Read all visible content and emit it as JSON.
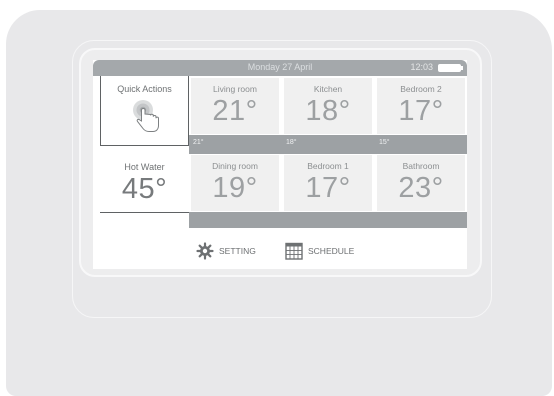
{
  "status_bar": {
    "date": "Monday 27 April",
    "time": "12:03"
  },
  "quick_actions": {
    "label": "Quick Actions"
  },
  "hot_water": {
    "label": "Hot Water",
    "temp": "45°"
  },
  "rooms": [
    {
      "name": "Living room",
      "temp": "21°"
    },
    {
      "name": "Kitchen",
      "temp": "18°"
    },
    {
      "name": "Bedroom 2",
      "temp": "17°"
    },
    {
      "name": "Dining room",
      "temp": "19°"
    },
    {
      "name": "Bedroom 1",
      "temp": "17°"
    },
    {
      "name": "Bathroom",
      "temp": "23°"
    }
  ],
  "mini_temps": [
    "21°",
    "18°",
    "15°"
  ],
  "toolbar": {
    "setting_label": "SETTING",
    "schedule_label": "SCHEDULE"
  },
  "icons": [
    "touch-hand-icon",
    "gear-icon",
    "calendar-icon",
    "battery-icon"
  ],
  "colors": {
    "status_bar": "#a4a8ab",
    "tile_bg": "#f0f0f0",
    "strip": "#9da1a4",
    "device": "#e8e8ea"
  }
}
